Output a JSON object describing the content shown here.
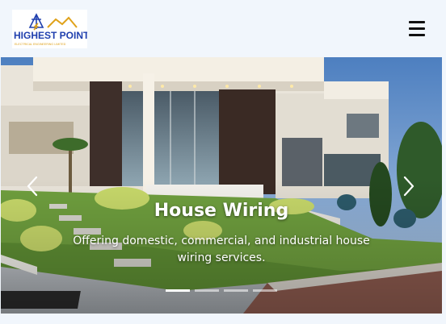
{
  "brand": {
    "name": "HIGHEST POINT",
    "tagline": "ELECTRICAL ENGINEERING LIMITED"
  },
  "navbar": {
    "menu_icon": "hamburger-menu-icon"
  },
  "carousel": {
    "slides": [
      {
        "title": "House Wiring",
        "text": "Offering domestic, commercial, and industrial house wiring services."
      }
    ],
    "active_slide": 1,
    "indicator_count": 4,
    "prev_icon": "chevron-left-icon",
    "next_icon": "chevron-right-icon"
  },
  "colors": {
    "brand_blue": "#1f3fae",
    "brand_gold": "#e0a21a",
    "page_bg": "#f1f6fc"
  }
}
